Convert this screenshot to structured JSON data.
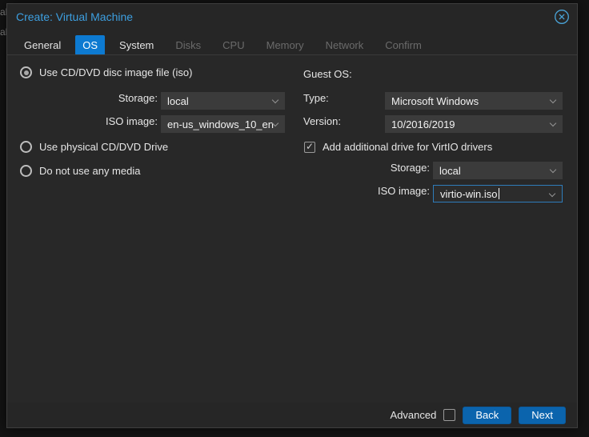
{
  "backdrop": {
    "fragments": [
      "al",
      "al"
    ]
  },
  "dialog": {
    "title": "Create: Virtual Machine"
  },
  "tabs": [
    {
      "label": "General",
      "state": "enabled"
    },
    {
      "label": "OS",
      "state": "active"
    },
    {
      "label": "System",
      "state": "enabled"
    },
    {
      "label": "Disks",
      "state": "disabled"
    },
    {
      "label": "CPU",
      "state": "disabled"
    },
    {
      "label": "Memory",
      "state": "disabled"
    },
    {
      "label": "Network",
      "state": "disabled"
    },
    {
      "label": "Confirm",
      "state": "disabled"
    }
  ],
  "media": {
    "iso_radio_label": "Use CD/DVD disc image file (iso)",
    "iso_radio_selected": true,
    "storage_label": "Storage:",
    "storage_value": "local",
    "iso_image_label": "ISO image:",
    "iso_image_value": "en-us_windows_10_en",
    "physical_radio_label": "Use physical CD/DVD Drive",
    "physical_radio_selected": false,
    "no_media_radio_label": "Do not use any media",
    "no_media_radio_selected": false
  },
  "guest_os": {
    "heading": "Guest OS:",
    "type_label": "Type:",
    "type_value": "Microsoft Windows",
    "version_label": "Version:",
    "version_value": "10/2016/2019",
    "virtio_label": "Add additional drive for VirtIO drivers",
    "virtio_checked": true,
    "storage_label": "Storage:",
    "storage_value": "local",
    "iso_image_label": "ISO image:",
    "iso_image_value": "virtio-win.iso",
    "iso_image_focused": true
  },
  "footer": {
    "advanced_label": "Advanced",
    "advanced_checked": false,
    "back_label": "Back",
    "next_label": "Next"
  },
  "colors": {
    "title_blue": "#3d9fe0",
    "tab_active_bg": "#0d7ad1",
    "button_bg": "#0b64ad",
    "focus_border": "#2e7cba",
    "field_bg": "#3b3b3b",
    "dialog_bg": "#262626",
    "panel_bg": "#282828"
  }
}
